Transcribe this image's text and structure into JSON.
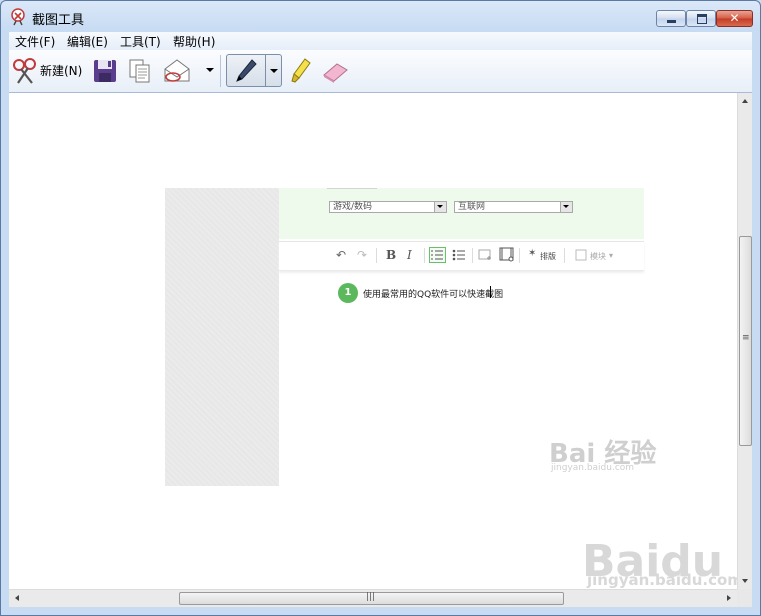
{
  "window": {
    "title": "截图工具"
  },
  "menu": [
    {
      "label": "文件(F)"
    },
    {
      "label": "编辑(E)"
    },
    {
      "label": "工具(T)"
    },
    {
      "label": "帮助(H)"
    }
  ],
  "toolbar": {
    "new_label": "新建(N)",
    "icons": [
      "scissors-icon",
      "save-icon",
      "copy-icon",
      "send-email-icon",
      "pen-icon",
      "highlighter-icon",
      "eraser-icon"
    ]
  },
  "capture": {
    "select1": "游戏/数码",
    "select2": "互联网",
    "editor": {
      "bold": "B",
      "italic": "I",
      "layout_label": "排版",
      "module_label": "模块"
    },
    "step": {
      "number": "1",
      "text": "使用最常用的QQ软件可以快速截图"
    }
  },
  "watermarks": {
    "small_main": "Bai 经验",
    "small_url": "jingyan.baidu.com",
    "large_main": "Baidu 经验",
    "large_url": "jingyan.baidu.com"
  },
  "colors": {
    "titlebar": "#c7dbf3",
    "close_button": "#c43a25",
    "step_badge": "#5cb85c",
    "green_panel": "#eefaec"
  }
}
